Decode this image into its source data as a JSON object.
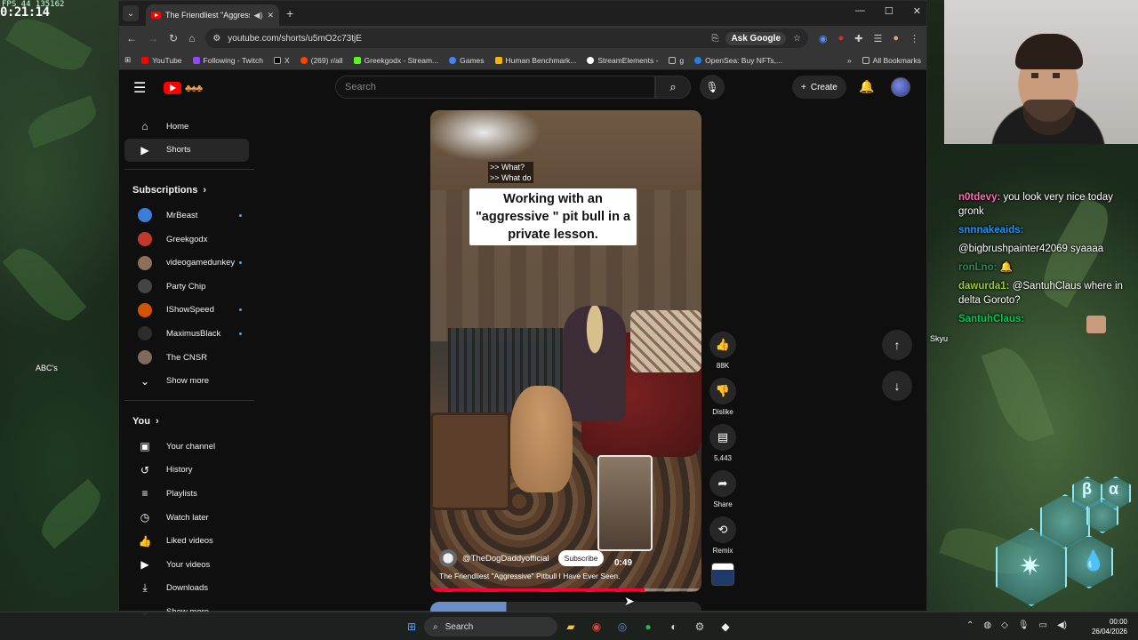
{
  "overlay": {
    "fps": "FPS 44 135162",
    "clock": "0:21:14",
    "abc_label": "ABC's",
    "skyu_label": "Skyu"
  },
  "browser": {
    "tab_title": "The Friendliest \"Aggressive\"",
    "url": "youtube.com/shorts/u5mO2c73tjE",
    "ask_google": "Ask Google",
    "bookmarks": [
      {
        "label": "YouTube",
        "color": "#ff0000"
      },
      {
        "label": "Following - Twitch",
        "color": "#9146ff"
      },
      {
        "label": "X",
        "color": "#000000"
      },
      {
        "label": "(269) r/all",
        "color": "#ff4500"
      },
      {
        "label": "Greekgodx - Stream...",
        "color": "#53fc18"
      },
      {
        "label": "Games",
        "color": "#4285f4"
      },
      {
        "label": "Human Benchmark...",
        "color": "#f7b500"
      },
      {
        "label": "StreamElements -",
        "color": "#ffffff"
      },
      {
        "label": "g",
        "color": "#888888"
      },
      {
        "label": "OpenSea: Buy NFTs,...",
        "color": "#2081e2"
      }
    ],
    "all_bookmarks": "All Bookmarks"
  },
  "youtube": {
    "search_placeholder": "Search",
    "create_label": "Create",
    "sidebar": {
      "main": [
        {
          "label": "Home",
          "icon": "home-icon"
        },
        {
          "label": "Shorts",
          "icon": "shorts-icon",
          "active": true
        }
      ],
      "subscriptions_title": "Subscriptions",
      "subscriptions": [
        {
          "label": "MrBeast",
          "color": "#3b7dd8",
          "new": true
        },
        {
          "label": "Greekgodx",
          "color": "#c0392b",
          "new": false
        },
        {
          "label": "videogamedunkey",
          "color": "#8e6f5a",
          "new": true
        },
        {
          "label": "Party Chip",
          "color": "#444444",
          "new": false
        },
        {
          "label": "IShowSpeed",
          "color": "#d35400",
          "new": true
        },
        {
          "label": "MaximusBlack",
          "color": "#2c2c2c",
          "new": true
        },
        {
          "label": "The CNSR",
          "color": "#7f6a5e",
          "new": false
        }
      ],
      "show_more": "Show more",
      "you_title": "You",
      "you_items": [
        {
          "label": "Your channel",
          "icon": "channel-icon"
        },
        {
          "label": "History",
          "icon": "history-icon"
        },
        {
          "label": "Playlists",
          "icon": "playlists-icon"
        },
        {
          "label": "Watch later",
          "icon": "watch-later-icon"
        },
        {
          "label": "Liked videos",
          "icon": "like-icon"
        },
        {
          "label": "Your videos",
          "icon": "your-videos-icon"
        },
        {
          "label": "Downloads",
          "icon": "download-icon"
        }
      ],
      "show_more_2": "Show more"
    },
    "short": {
      "caption_top": ">> What?\n>> What do",
      "caption": "Working with an \"aggressive \" pit bull in a private lesson.",
      "channel": "@TheDogDaddyofficial",
      "subscribe": "Subscribe",
      "preview_time": "0:49",
      "title": "The Friendliest \"Aggressive\" Pitbull I Have Ever Seen.",
      "progress": 0.79
    },
    "actions": {
      "likes": "88K",
      "dislike": "Dislike",
      "comments": "5,443",
      "share": "Share",
      "remix": "Remix"
    }
  },
  "chat": [
    {
      "user": "n0tdevy:",
      "color": "#ff69b4",
      "text": " you look very nice today gronk"
    },
    {
      "user": "snnnakeaids:",
      "color": "#1e90ff",
      "text": ""
    },
    {
      "user": "",
      "color": "#ffffff",
      "text": "@bigbrushpainter42069 syaaaa"
    },
    {
      "user": "ronLno:",
      "color": "#2e8b57",
      "text": " 🔔"
    },
    {
      "user": "dawurda1:",
      "color": "#9acd32",
      "text": " @SantuhClaus where in delta Goroto?"
    },
    {
      "user": "SantuhClaus:",
      "color": "#00c853",
      "text": ""
    }
  ],
  "hex_letters": [
    "β",
    "α"
  ],
  "taskbar": {
    "search": "Search",
    "time": "00:00",
    "date": "26/04/2026"
  }
}
